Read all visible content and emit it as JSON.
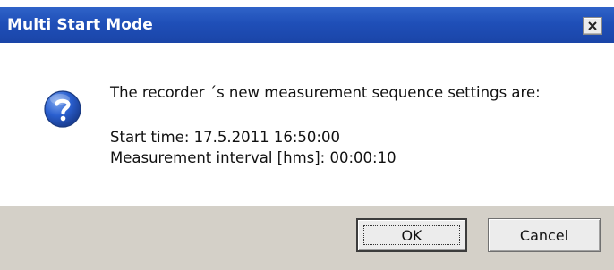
{
  "window": {
    "title": "Multi Start Mode",
    "close_glyph": "✕"
  },
  "message": {
    "icon": "question-icon",
    "line1": "The recorder ´s new measurement sequence settings are:",
    "line2": "Start time: 17.5.2011 16:50:00",
    "line3": "Measurement interval [hms]: 00:00:10"
  },
  "buttons": {
    "ok_label": "OK",
    "cancel_label": "Cancel"
  },
  "colors": {
    "titlebar": "#1f4fb8",
    "footer": "#d4d0c8",
    "icon": "#2a5fcf"
  }
}
